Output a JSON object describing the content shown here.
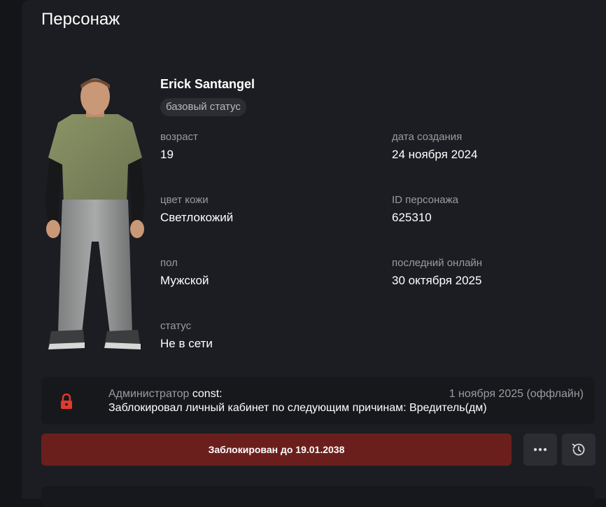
{
  "panel": {
    "title": "Персонаж"
  },
  "character": {
    "name": "Erick Santangel",
    "badge": "базовый статус",
    "fields": {
      "age": {
        "label": "возраст",
        "value": "19"
      },
      "created": {
        "label": "дата создания",
        "value": "24 ноября 2024"
      },
      "skin": {
        "label": "цвет кожи",
        "value": "Светлокожий"
      },
      "id": {
        "label": "ID персонажа",
        "value": "625310"
      },
      "gender": {
        "label": "пол",
        "value": "Мужской"
      },
      "last_online": {
        "label": "последний онлайн",
        "value": "30 октября 2025"
      },
      "status": {
        "label": "статус",
        "value": "Не в сети"
      }
    }
  },
  "ban": {
    "admin_prefix": "Администратор",
    "admin_name": "const:",
    "date": "1 ноября 2025 (оффлайн)",
    "reason": "Заблокировал личный кабинет по следующим причинам: Вредитель(дм)",
    "lock_color": "#e03a2f"
  },
  "actions": {
    "blocked_label": "Заблокирован до 19.01.2038",
    "blocked_color": "#6b1f1c",
    "more_icon": "more-dots-icon",
    "history_icon": "history-clock-icon"
  }
}
